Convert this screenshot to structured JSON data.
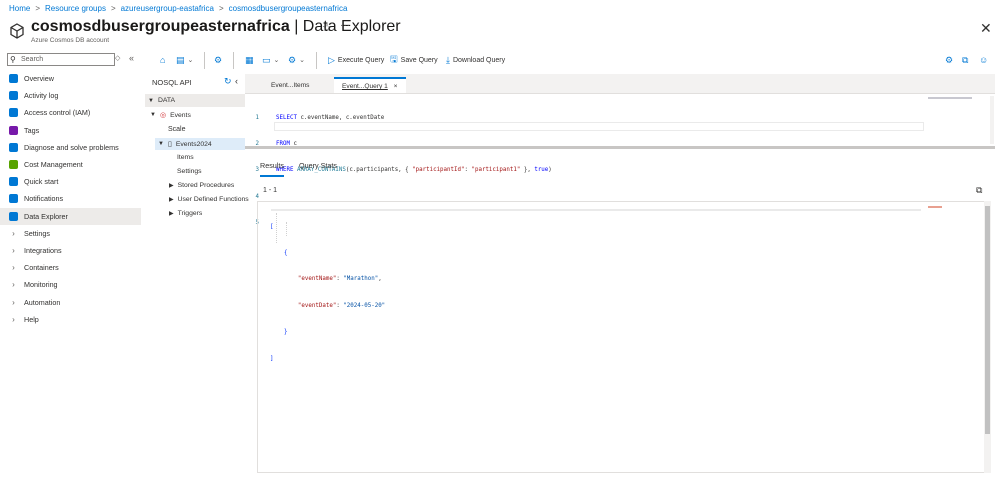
{
  "breadcrumb": {
    "items": [
      "Home",
      "Resource groups",
      "azureusergroup-eastafrica",
      "cosmosdbusergroupeasternafrica"
    ],
    "separator": ">"
  },
  "header": {
    "title_resource": "cosmosdbusergroupeasternafrica",
    "title_separator": " | ",
    "title_page": "Data Explorer",
    "subtitle": "Azure Cosmos DB account",
    "star": "☆",
    "more": "···",
    "close": "✕"
  },
  "nav": {
    "search_placeholder": "Search",
    "items": [
      {
        "label": "Overview",
        "icon": "overview-icon",
        "color": "#0078d4"
      },
      {
        "label": "Activity log",
        "icon": "activity-log-icon",
        "color": "#0078d4"
      },
      {
        "label": "Access control (IAM)",
        "icon": "iam-icon",
        "color": "#0078d4"
      },
      {
        "label": "Tags",
        "icon": "tag-icon",
        "color": "#7719aa"
      },
      {
        "label": "Diagnose and solve problems",
        "icon": "wrench-icon",
        "color": "#0078d4"
      },
      {
        "label": "Cost Management",
        "icon": "cost-icon",
        "color": "#57a300"
      },
      {
        "label": "Quick start",
        "icon": "cloud-icon",
        "color": "#0078d4"
      },
      {
        "label": "Notifications",
        "icon": "notification-icon",
        "color": "#0078d4"
      },
      {
        "label": "Data Explorer",
        "icon": "cube-icon",
        "color": "#0078d4"
      }
    ],
    "groups": [
      "Settings",
      "Integrations",
      "Containers",
      "Monitoring",
      "Automation",
      "Help"
    ],
    "active_index": 8
  },
  "toolbar": {
    "execute_label": "Execute Query",
    "save_label": "Save Query",
    "download_label": "Download Query"
  },
  "tree": {
    "api_label": "NOSQL API",
    "data_label": "DATA",
    "database": "Events",
    "scale": "Scale",
    "container": "Events2024",
    "children": [
      "Items",
      "Settings"
    ],
    "expandables": [
      "Stored Procedures",
      "User Defined Functions",
      "Triggers"
    ]
  },
  "editor": {
    "tabs": [
      "Event...Items",
      "Event...Query 1"
    ],
    "active_tab": 1,
    "close_glyph": "×",
    "line_numbers": [
      "1",
      "2",
      "3",
      "4",
      "5"
    ],
    "lines": [
      [
        "SELECT",
        " c.eventName, c.eventDate"
      ],
      [
        "FROM",
        " c"
      ],
      [
        "WHERE",
        " ",
        "ARRAY_CONTAINS",
        "(c.participants, { ",
        "\"participantId\"",
        ": ",
        "\"participant1\"",
        " }, ",
        "true",
        ")"
      ]
    ]
  },
  "results": {
    "tabs": [
      "Results",
      "Query Stats"
    ],
    "count": "1 - 1",
    "json_lines": [
      "[",
      "    {",
      "        \"eventName\": \"Marathon\",",
      "        \"eventDate\": \"2024-05-20\"",
      "    }",
      "]"
    ],
    "key1": "\"eventName\"",
    "val1": "\"Marathon\"",
    "key2": "\"eventDate\"",
    "val2": "\"2024-05-20\""
  }
}
